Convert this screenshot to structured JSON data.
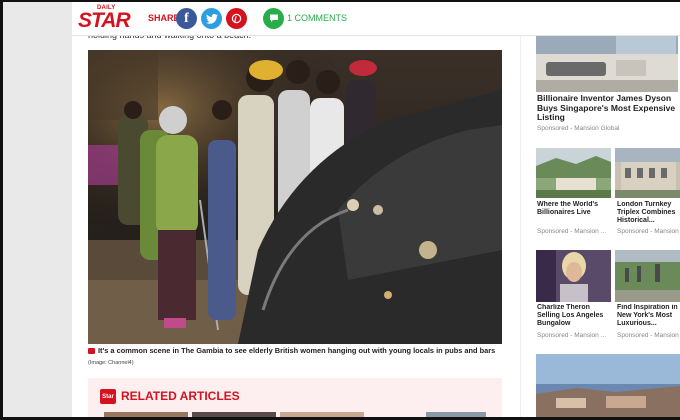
{
  "header": {
    "logo_daily": "DAILY",
    "logo_star": "STAR",
    "share_label": "SHARE",
    "fb_glyph": "f",
    "comments_text": "1 COMMENTS"
  },
  "article": {
    "prev_text": "holding hands and walking onto a beach.",
    "caption": "It's a common scene in The Gambia to see elderly British women hanging out with young locals in pubs and bars",
    "credit": "(Image: Channel4)",
    "related_title": "RELATED ARTICLES",
    "related_icon_text": "Star"
  },
  "sidebar": {
    "ads": [
      {
        "title": "Billionaire Inventor James Dyson Buys Singapore's Most Expensive Listing",
        "source": "Sponsored - Mansion Global"
      },
      {
        "title": "Where the World's Billionaires Live",
        "source": "Sponsored - Mansion ..."
      },
      {
        "title": "London Turnkey Triplex Combines Historical...",
        "source": "Sponsored - Mansion ..."
      },
      {
        "title": "Charlize Theron Selling Los Angeles Bungalow",
        "source": "Sponsored - Mansion ..."
      },
      {
        "title": "Find Inspiration in New York's Most Luxurious...",
        "source": "Sponsored - Mansion ..."
      }
    ]
  },
  "colors": {
    "brand_red": "#d5121e",
    "facebook": "#3b5998",
    "twitter": "#2b9fe0",
    "comments_green": "#27ae48"
  },
  "icons": [
    "facebook-icon",
    "twitter-icon",
    "pinterest-icon",
    "comment-icon",
    "camera-icon"
  ]
}
